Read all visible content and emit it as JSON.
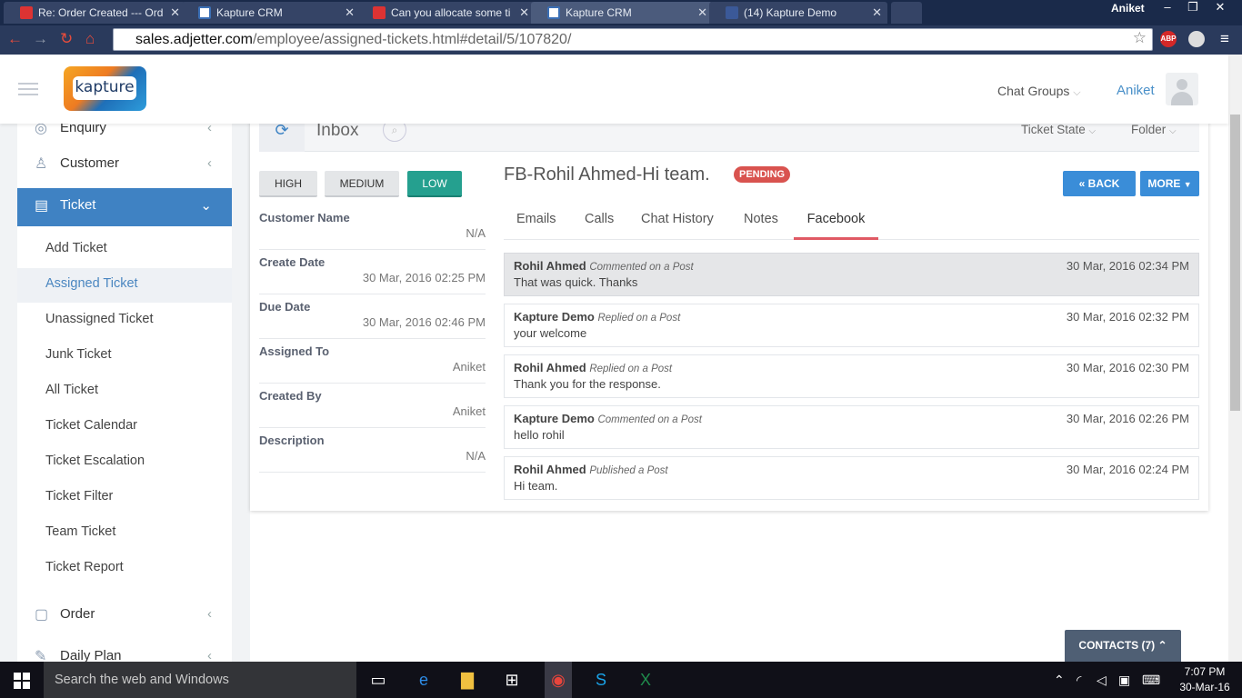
{
  "browser": {
    "tabs": [
      {
        "title": "Re: Order Created --- Ord",
        "icon": "gmail-icon"
      },
      {
        "title": "Kapture CRM",
        "icon": "kapture-icon"
      },
      {
        "title": "Can you allocate some ti",
        "icon": "gmail-icon"
      },
      {
        "title": "Kapture CRM",
        "icon": "kapture-icon"
      },
      {
        "title": "(14) Kapture Demo",
        "icon": "facebook-icon"
      }
    ],
    "profile_name": "Aniket",
    "url_host": "sales.adjetter.com",
    "url_path": "/employee/assigned-tickets.html#detail/5/107820/",
    "ext_abp": "ABP"
  },
  "header": {
    "logo_text": "kapture",
    "chat_groups": "Chat Groups",
    "user": "Aniket"
  },
  "sidebar": {
    "items": [
      {
        "label": "Enquiry",
        "icon": "enquiry-icon"
      },
      {
        "label": "Customer",
        "icon": "user-icon"
      },
      {
        "label": "Ticket",
        "icon": "clipboard-icon"
      },
      {
        "label": "Order",
        "icon": "clipboard-icon"
      },
      {
        "label": "Daily Plan",
        "icon": "edit-icon"
      }
    ],
    "ticket_sub": [
      "Add Ticket",
      "Assigned Ticket",
      "Unassigned Ticket",
      "Junk Ticket",
      "All Ticket",
      "Ticket Calendar",
      "Ticket Escalation",
      "Ticket Filter",
      "Team Ticket",
      "Ticket Report"
    ]
  },
  "inbox": {
    "title": "Inbox",
    "ticket_state": "Ticket State",
    "folder": "Folder"
  },
  "priority": {
    "high": "HIGH",
    "medium": "MEDIUM",
    "low": "LOW",
    "selected": "LOW"
  },
  "details": [
    {
      "label": "Customer Name",
      "value": "N/A"
    },
    {
      "label": "Create Date",
      "value": "30 Mar, 2016 02:25 PM"
    },
    {
      "label": "Due Date",
      "value": "30 Mar, 2016 02:46 PM"
    },
    {
      "label": "Assigned To",
      "value": "Aniket"
    },
    {
      "label": "Created By",
      "value": "Aniket"
    },
    {
      "label": "Description",
      "value": "N/A"
    }
  ],
  "ticket": {
    "title": "FB-Rohil Ahmed-Hi team.",
    "status": "PENDING",
    "back": "BACK",
    "more": "MORE"
  },
  "tabs": [
    "Emails",
    "Calls",
    "Chat History",
    "Notes",
    "Facebook"
  ],
  "active_tab": "Facebook",
  "messages": [
    {
      "author": "Rohil Ahmed",
      "action": "Commented on a Post",
      "time": "30 Mar, 2016 02:34 PM",
      "text": "That was quick. Thanks"
    },
    {
      "author": "Kapture Demo",
      "action": "Replied on a Post",
      "time": "30 Mar, 2016 02:32 PM",
      "text": "your welcome"
    },
    {
      "author": "Rohil Ahmed",
      "action": "Replied on a Post",
      "time": "30 Mar, 2016 02:30 PM",
      "text": "Thank you for the response."
    },
    {
      "author": "Kapture Demo",
      "action": "Commented on a Post",
      "time": "30 Mar, 2016 02:26 PM",
      "text": "hello rohil"
    },
    {
      "author": "Rohil Ahmed",
      "action": "Published a Post",
      "time": "30 Mar, 2016 02:24 PM",
      "text": "Hi team."
    }
  ],
  "contacts": "CONTACTS (7)",
  "taskbar": {
    "search_placeholder": "Search the web and Windows",
    "time": "7:07 PM",
    "date": "30-Mar-16"
  },
  "colors": {
    "accent": "#3f82c3",
    "low": "#25a08f",
    "pending": "#d9534f",
    "tab_underline": "#e05a64"
  }
}
